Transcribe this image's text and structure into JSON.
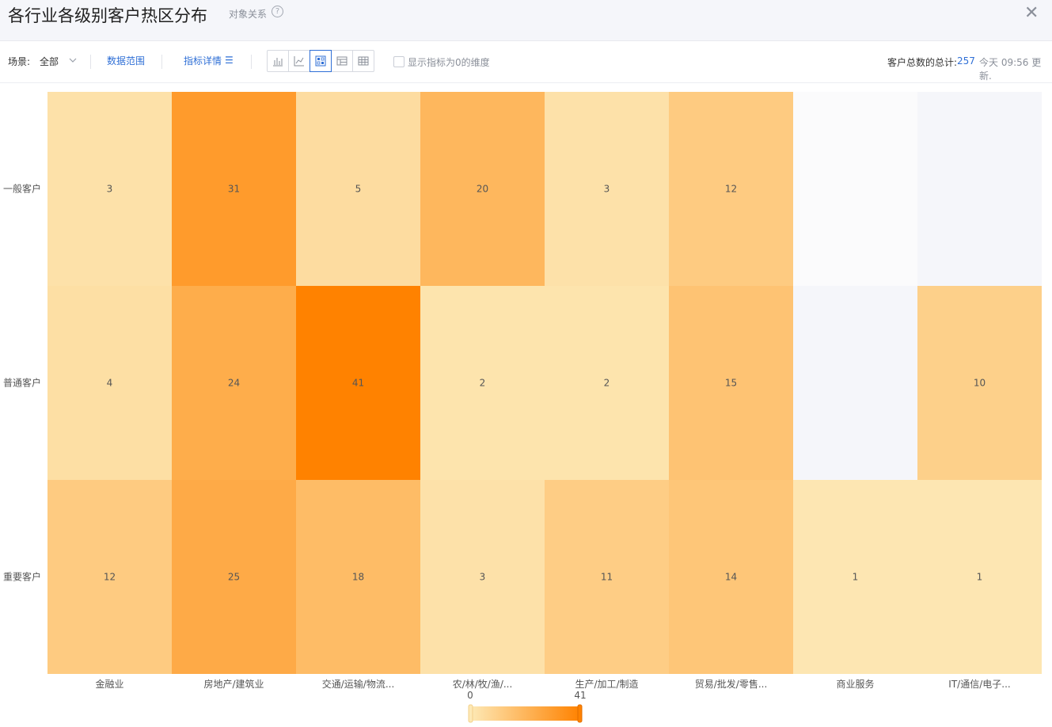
{
  "header": {
    "title": "各行业各级别客户热区分布",
    "subtitle": "对象关系",
    "help_icon": "question-circle-icon",
    "close_icon": "close-icon"
  },
  "toolbar": {
    "scene_label": "场景:",
    "scene_value": "全部",
    "data_range_label": "数据范围",
    "metric_detail_label": "指标详情",
    "view_buttons": [
      "bar-chart-icon",
      "line-chart-icon",
      "heatmap-icon",
      "pivot-table-icon",
      "table-icon"
    ],
    "active_view": "heatmap-icon",
    "show_zero_label": "显示指标为0的维度",
    "total_label": "客户总数的总计:",
    "total_value": "257",
    "update_text": "今天 09:56 更新."
  },
  "colors": {
    "accent": "#2f6fd6",
    "heat_low": "#fde9b6",
    "heat_high": "#ff8200",
    "empty": "#f5f6fa"
  },
  "chart_data": {
    "type": "heatmap",
    "title": "",
    "x_categories": [
      "金融业",
      "房地产/建筑业",
      "交通/运输/物流...",
      "农/林/牧/渔/...",
      "生产/加工/制造",
      "贸易/批发/零售...",
      "商业服务",
      "IT/通信/电子..."
    ],
    "y_categories": [
      "一般客户",
      "普通客户",
      "重要客户"
    ],
    "values": [
      [
        3,
        31,
        5,
        20,
        3,
        12,
        null,
        null
      ],
      [
        4,
        24,
        41,
        2,
        2,
        15,
        null,
        10
      ],
      [
        12,
        25,
        18,
        3,
        11,
        14,
        1,
        1
      ]
    ],
    "color_range": [
      0,
      41
    ],
    "legend": {
      "min_label": "0",
      "max_label": "41",
      "placement": "bottom-center"
    }
  }
}
